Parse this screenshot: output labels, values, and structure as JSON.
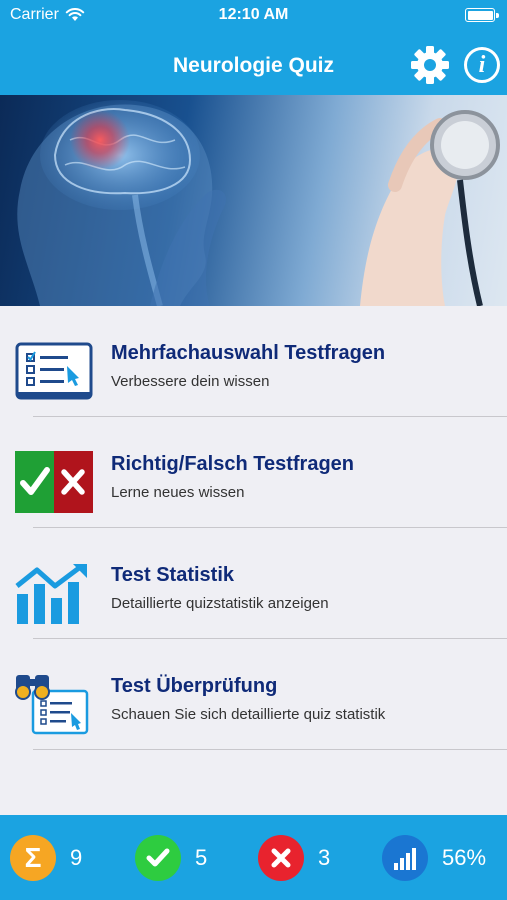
{
  "status_bar": {
    "carrier": "Carrier",
    "time": "12:10 AM"
  },
  "nav": {
    "title": "Neurologie Quiz",
    "info_glyph": "i"
  },
  "menu": [
    {
      "title": "Mehrfachauswahl Testfragen",
      "subtitle": "Verbessere dein wissen",
      "icon": "multiple-choice-icon"
    },
    {
      "title": "Richtig/Falsch Testfragen",
      "subtitle": "Lerne neues wissen",
      "icon": "true-false-icon"
    },
    {
      "title": "Test Statistik",
      "subtitle": "Detaillierte quizstatistik anzeigen",
      "icon": "statistics-chart-icon"
    },
    {
      "title": "Test Überprüfung",
      "subtitle": "Schauen Sie sich detaillierte quiz statistik",
      "icon": "review-binoculars-icon"
    }
  ],
  "stats": {
    "total": {
      "value": "9",
      "color": "#f6a623",
      "glyph": "Σ"
    },
    "correct": {
      "value": "5",
      "color": "#2ecc40"
    },
    "wrong": {
      "value": "3",
      "color": "#e8232e"
    },
    "percent": {
      "value": "56%",
      "color": "#1a76d2"
    }
  },
  "colors": {
    "header": "#1ba3e1",
    "title_text": "#0f2a78",
    "background": "#efeff4"
  }
}
